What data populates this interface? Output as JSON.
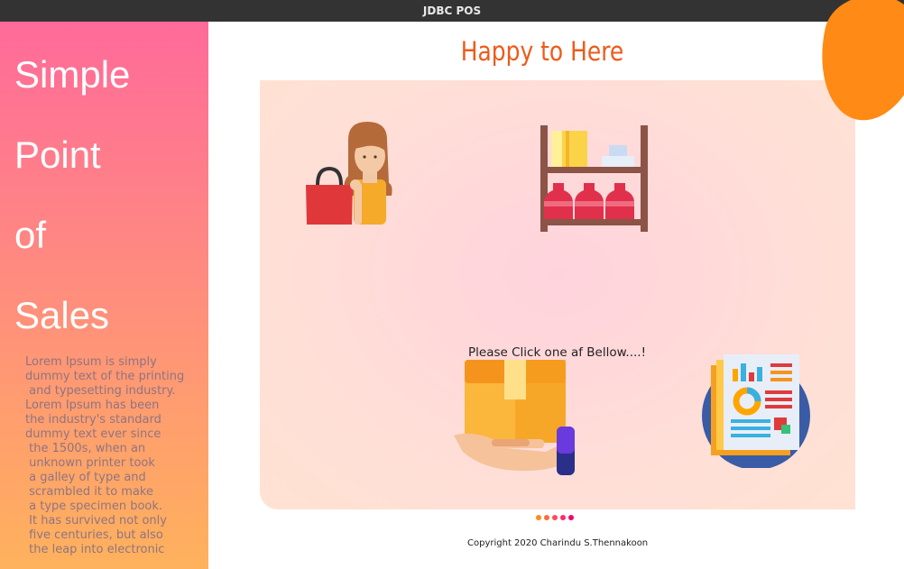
{
  "window": {
    "title": "JDBC POS",
    "controls": [
      "minimize",
      "maximize",
      "close"
    ],
    "colors": {
      "minimize": "#f5bf2c",
      "maximize": "#2ccc43",
      "close": "#e8484a"
    }
  },
  "sidebar": {
    "title_lines": [
      "Simple",
      "Point",
      "of",
      "Sales"
    ],
    "description": "Lorem Ipsum is simply\ndummy text of the printing\n and typesetting industry.\nLorem Ipsum has been\nthe industry's standard\ndummy text ever since\n the 1500s, when an\n unknown printer took\n a galley of type and\n scrambled it to make\n a type specimen book.\n It has survived not only\n five centuries, but also\n the leap into electronic",
    "gradient": [
      "#ff6a9a",
      "#ff8a80",
      "#ffb25c"
    ]
  },
  "main": {
    "heading": "Happy to Here",
    "prompt": "Please Click one af Bellow....!",
    "copyright": "Copyright 2020 Charindu S.Thennakoon",
    "accent": "#ee5a1a",
    "cards": [
      {
        "icon": "customer-shopping-icon"
      },
      {
        "icon": "store-shelf-icon"
      },
      {
        "icon": "delivery-box-icon"
      },
      {
        "icon": "report-chart-icon"
      }
    ],
    "page_dots": [
      "#ff8a15",
      "#ff6a3a",
      "#ff4a5a",
      "#ff2a6a",
      "#f5006f"
    ]
  }
}
